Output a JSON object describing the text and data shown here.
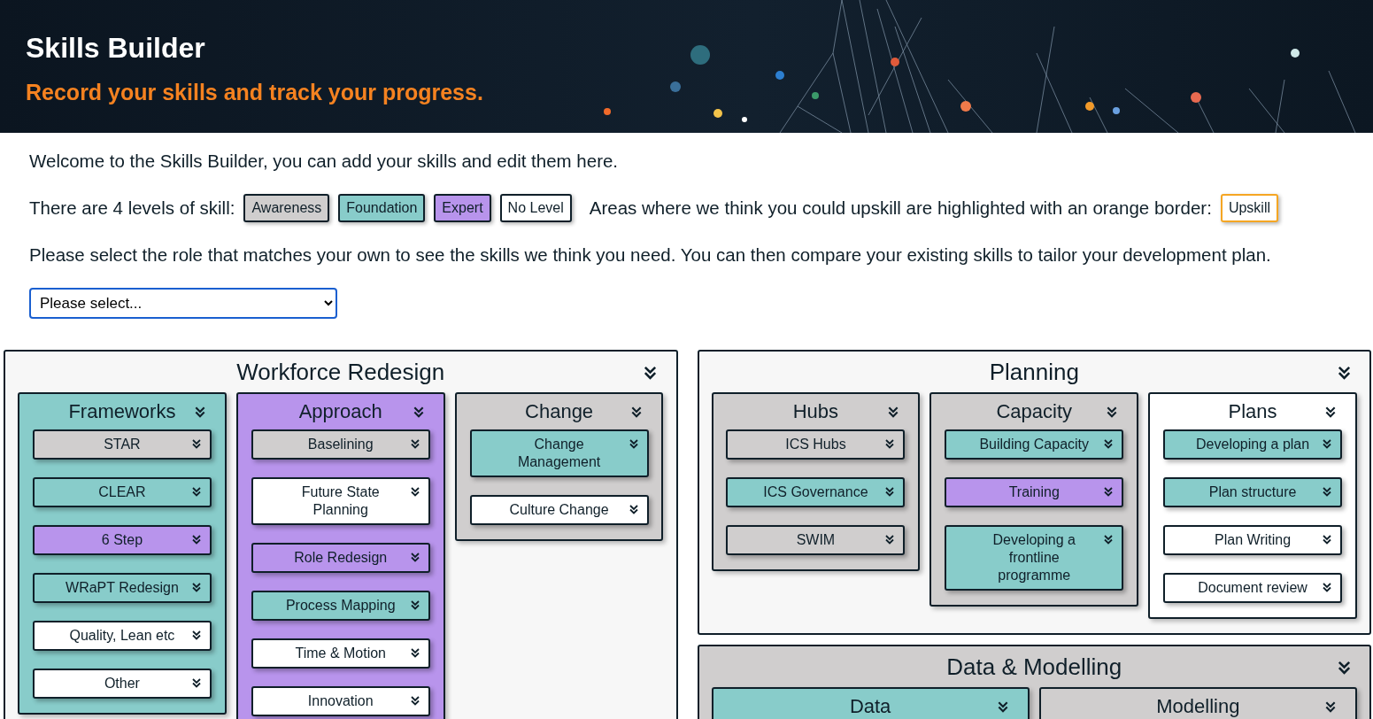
{
  "header": {
    "title": "Skills Builder",
    "subtitle": "Record your skills and track your progress."
  },
  "intro": {
    "welcome": "Welcome to the Skills Builder, you can add your skills and edit them here.",
    "levels_label": "There are 4 levels of skill:",
    "levels": [
      {
        "label": "Awareness",
        "color": "#d0cece"
      },
      {
        "label": "Foundation",
        "color": "#88ccca"
      },
      {
        "label": "Expert",
        "color": "#b894ec"
      },
      {
        "label": "No Level",
        "color": "#ffffff"
      }
    ],
    "upskill_text": "Areas where we think you could upskill are highlighted with an orange border:",
    "upskill_sample": {
      "label": "Upskill",
      "highlighted": true
    },
    "role_prompt": "Please select the role that matches your own to see the skills we think you need. You can then compare your existing skills to tailor your development plan.",
    "role_select": {
      "value": "Please select..."
    }
  },
  "columns": [
    {
      "sections": [
        {
          "title": "Workforce Redesign",
          "color": "#f7f7f7",
          "groups": [
            {
              "title": "Frameworks",
              "color": "#88ccca",
              "items": [
                {
                  "label": "STAR",
                  "color": "#d0cece"
                },
                {
                  "label": "CLEAR",
                  "color": "#88ccca"
                },
                {
                  "label": "6 Step",
                  "color": "#b894ec"
                },
                {
                  "label": "WRaPT Redesign",
                  "color": "#88ccca"
                },
                {
                  "label": "Quality, Lean etc",
                  "color": "#ffffff"
                },
                {
                  "label": "Other",
                  "color": "#ffffff"
                }
              ]
            },
            {
              "title": "Approach",
              "color": "#b894ec",
              "items": [
                {
                  "label": "Baselining",
                  "color": "#d0cece"
                },
                {
                  "label": "Future State Planning",
                  "color": "#ffffff"
                },
                {
                  "label": "Role Redesign",
                  "color": "#b894ec"
                },
                {
                  "label": "Process Mapping",
                  "color": "#88ccca"
                },
                {
                  "label": "Time & Motion",
                  "color": "#ffffff"
                },
                {
                  "label": "Innovation",
                  "color": "#ffffff"
                }
              ]
            },
            {
              "title": "Change",
              "color": "#d0cece",
              "items": [
                {
                  "label": "Change Management",
                  "color": "#88ccca"
                },
                {
                  "label": "Culture Change",
                  "color": "#ffffff"
                }
              ]
            }
          ]
        }
      ]
    },
    {
      "sections": [
        {
          "title": "Planning",
          "color": "#f7f7f7",
          "groups": [
            {
              "title": "Hubs",
              "color": "#d0cece",
              "items": [
                {
                  "label": "ICS Hubs",
                  "color": "#d0cece"
                },
                {
                  "label": "ICS Governance",
                  "color": "#88ccca"
                },
                {
                  "label": "SWIM",
                  "color": "#d0cece"
                }
              ]
            },
            {
              "title": "Capacity",
              "color": "#d0cece",
              "items": [
                {
                  "label": "Building Capacity",
                  "color": "#88ccca"
                },
                {
                  "label": "Training",
                  "color": "#b894ec"
                },
                {
                  "label": "Developing a frontline programme",
                  "color": "#88ccca"
                }
              ]
            },
            {
              "title": "Plans",
              "color": "#ffffff",
              "items": [
                {
                  "label": "Developing a plan",
                  "color": "#88ccca"
                },
                {
                  "label": "Plan structure",
                  "color": "#88ccca"
                },
                {
                  "label": "Plan Writing",
                  "color": "#ffffff"
                },
                {
                  "label": "Document review",
                  "color": "#ffffff"
                }
              ]
            }
          ]
        },
        {
          "title": "Data & Modelling",
          "color": "#d0cece",
          "groups": [
            {
              "title": "Data",
              "color": "#88ccca"
            },
            {
              "title": "Modelling",
              "color": "#d0cece"
            }
          ]
        }
      ]
    }
  ]
}
